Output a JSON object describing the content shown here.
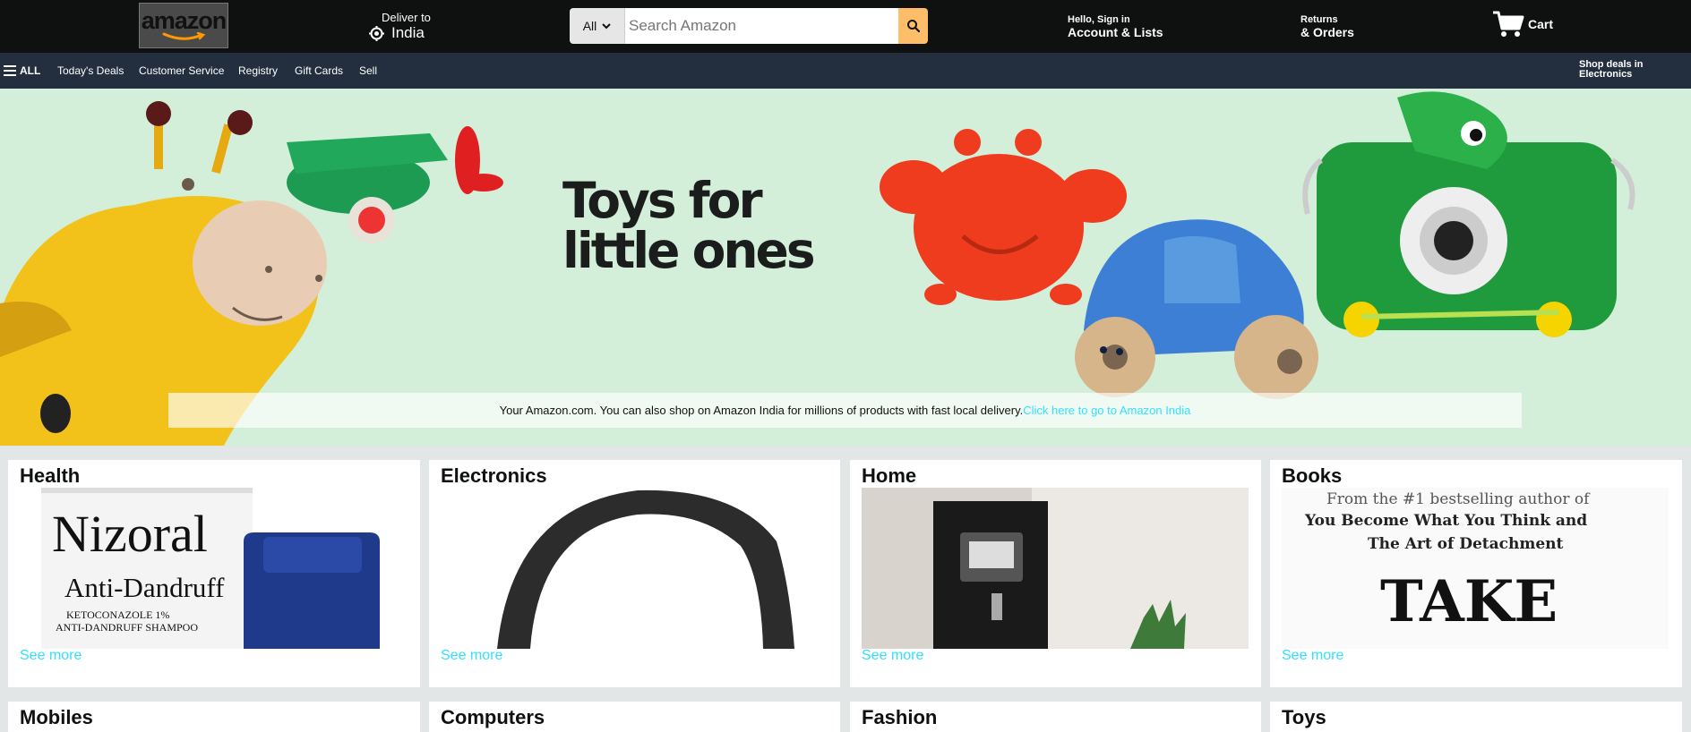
{
  "header": {
    "logo_text": "amazon",
    "deliver_label": "Deliver to",
    "deliver_location": "India",
    "search_category": "All",
    "search_placeholder": "Search Amazon",
    "account_small": "Hello, Sign in",
    "account_big": "Account & Lists",
    "returns_small": "Returns",
    "returns_big": "& Orders",
    "cart_label": "Cart"
  },
  "subnav": {
    "all_label": "ALL",
    "items": [
      "Today's Deals",
      "Customer Service",
      "Registry",
      "Gift Cards",
      "Sell"
    ],
    "shop_deals": "Shop deals in Electronics"
  },
  "hero": {
    "title_line1": "Toys for",
    "title_line2": "little ones",
    "notice_text": "Your Amazon.com. You can also shop on Amazon India for millions of products with fast local delivery.",
    "notice_link": "Click here to go to Amazon India"
  },
  "cards": [
    {
      "title": "Health",
      "link": "See more"
    },
    {
      "title": "Electronics",
      "link": "See more"
    },
    {
      "title": "Home",
      "link": "See more"
    },
    {
      "title": "Books",
      "link": "See more"
    },
    {
      "title": "Mobiles"
    },
    {
      "title": "Computers"
    },
    {
      "title": "Fashion"
    },
    {
      "title": "Toys"
    }
  ],
  "card_images": {
    "health_brand": "Nizoral",
    "health_line2": "Anti-Dandruff",
    "health_line3": "KETOCONAZOLE 1%",
    "health_line4": "ANTI-DANDRUFF SHAMPOO",
    "book_line1": "From the #1 bestselling author of",
    "book_line2": "You Become What You Think and",
    "book_line3": "The Art of Detachment",
    "book_title": "TAKE"
  },
  "colors": {
    "nav_bg": "#0f1111",
    "subnav_bg": "#232f3e",
    "hero_bg": "#d3efd9",
    "search_button": "#febd69",
    "link": "#33e0ff"
  }
}
